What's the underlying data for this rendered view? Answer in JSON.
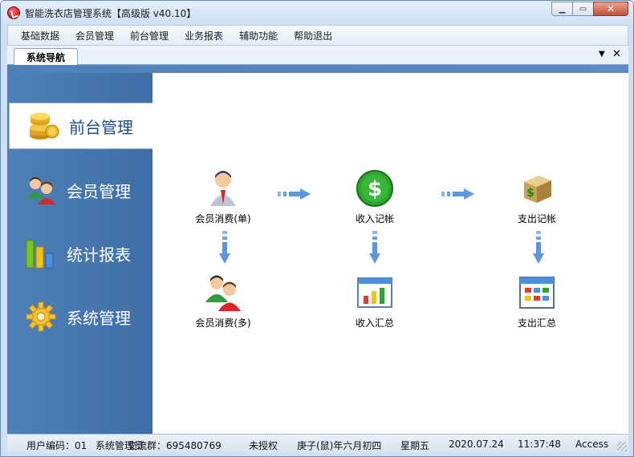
{
  "window": {
    "title": "智能洗衣店管理系统【高级版 v40.10】"
  },
  "menu": [
    "基础数据",
    "会员管理",
    "前台管理",
    "业务报表",
    "辅助功能",
    "帮助退出"
  ],
  "tab": {
    "label": "系统导航",
    "dropdown_glyph": "▼",
    "close_glyph": "✕"
  },
  "sidebar": {
    "items": [
      {
        "label": "前台管理",
        "icon": "coins-icon",
        "active": true
      },
      {
        "label": "会员管理",
        "icon": "members-icon",
        "active": false
      },
      {
        "label": "统计报表",
        "icon": "bar-chart-icon",
        "active": false
      },
      {
        "label": "系统管理",
        "icon": "gear-icon",
        "active": false
      }
    ]
  },
  "flow": {
    "nodes": {
      "member_single": "会员消费(单)",
      "income_record": "收入记帐",
      "expense_record": "支出记帐",
      "member_multi": "会员消费(多)",
      "income_summary": "收入汇总",
      "expense_summary": "支出汇总"
    }
  },
  "status": {
    "user_code": "用户编码：01",
    "role": "系统管理员",
    "exchange": "交流群：695480769",
    "license": "未授权",
    "lunar_date": "庚子(鼠)年六月初四",
    "weekday": "星期五",
    "date": "2020.07.24",
    "time": "11:37:48",
    "db": "Access"
  },
  "colors": {
    "sidebar": "#4f80b8",
    "active_label": "#1d4f86",
    "title_bg": "#dbe8f7"
  }
}
